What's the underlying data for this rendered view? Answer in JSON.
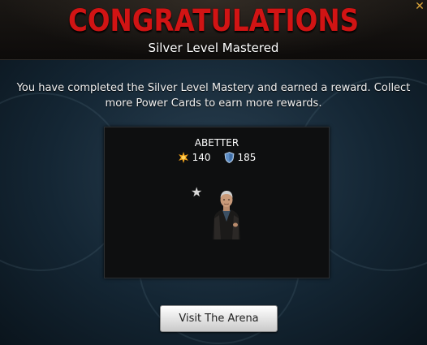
{
  "header": {
    "title": "CONGRATULATIONS",
    "subtitle": "Silver Level Mastered",
    "close_icon": "close-icon"
  },
  "message": "You have completed the Silver Level Mastery and earned a reward. Collect more Power Cards to earn more rewards.",
  "reward_card": {
    "name": "ABETTER",
    "attack": "140",
    "attack_icon": "attack-burst-icon",
    "defense": "185",
    "defense_icon": "shield-icon",
    "rarity_icon": "star-icon"
  },
  "actions": {
    "visit_arena_label": "Visit The Arena"
  },
  "colors": {
    "title": "#d11414",
    "attack_icon": "#f2a21a",
    "defense_icon": "#5f8fc7",
    "close_icon": "#d9a33a"
  }
}
